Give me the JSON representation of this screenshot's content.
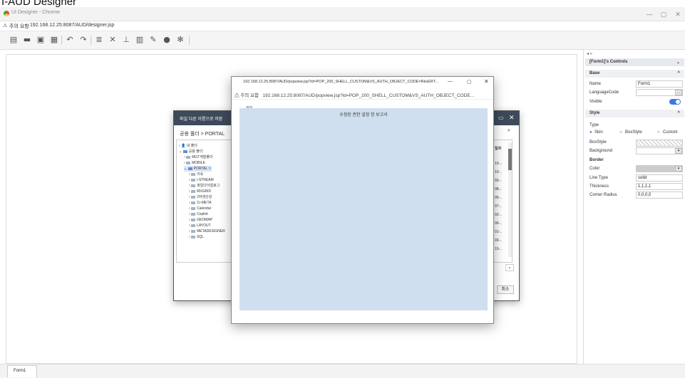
{
  "caption": "I-AUD Designer",
  "window": {
    "title": "UI Designer - Chrome",
    "min": "—",
    "max": "▢",
    "close": "✕"
  },
  "addressbar": {
    "warning": "주의 요함",
    "url": "192.168.12.25:8087/AUD/designer.jsp"
  },
  "toolbar": {
    "icons": [
      "new-icon",
      "open-icon",
      "save-icon",
      "save-as-icon",
      "undo-icon",
      "redo-icon",
      "database-icon",
      "tools-icon",
      "hierarchy-icon",
      "report-icon",
      "edit-icon",
      "run-icon",
      "settings-icon"
    ]
  },
  "rightpanel": {
    "header": "[Form1]'s Controls",
    "base": "Base",
    "name_label": "Name",
    "name_value": "Form1",
    "lang_label": "LanguageCode",
    "visible_label": "Visible",
    "style": "Style",
    "type_label": "Type",
    "type_options": [
      "Skin",
      "BoxStyle",
      "Custom"
    ],
    "boxstyle_label": "BoxStyle",
    "background_label": "Background",
    "border": "Border",
    "color_label": "Color",
    "linetype_label": "Line Type",
    "linetype_value": "solid",
    "thickness_label": "Thickness",
    "thickness_value": "1,1,1,1",
    "radius_label": "Corner Radius",
    "radius_value": "0,0,0,0"
  },
  "savedialog": {
    "title": "파일 다른 이름으로 저장",
    "path": "공용 폴더 > PORTAL",
    "tree": [
      "내 폴더",
      "공용 폴더",
      "MGT개발폴더",
      "MOBILE",
      "PORTAL",
      "이슈",
      "i-STREAM",
      "파일다이얼로그",
      "MXGRID",
      "2자생산성",
      "3.i-META",
      "Calendar",
      "Copilot",
      "GEOMAP",
      "LAYOUT",
      "METADESIGNER",
      "SQL"
    ],
    "col_header": "일자",
    "dates": [
      "10-..",
      "10-..",
      "03-..",
      "08-..",
      "05-..",
      "07-..",
      "02-..",
      "06-..",
      "01-..",
      "03-..",
      "10-.."
    ],
    "cancel": "취소"
  },
  "popup": {
    "title": "192.168.12.25:8087/AUD/popview.jsp?id=POP_200_SHELL_CUSTOM&VS_AUTH_OBJECT_CODE=RkxERT...",
    "warning": "주의 요함",
    "url": "192.168.12.25:8087/AUD/popview.jsp?id=POP_200_SHELL_CUSTOM&VS_AUTH_OBJECT_CODE...",
    "report_title": "수정된 권한 설정 창 보고서",
    "label": "권한"
  },
  "bottom": {
    "tab": "Form1"
  }
}
